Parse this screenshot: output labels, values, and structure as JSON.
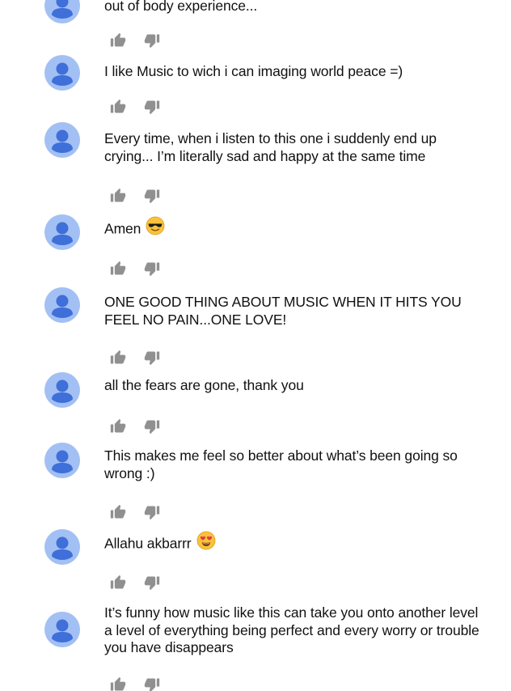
{
  "colors": {
    "avatar_bg": "#a3c0f4",
    "avatar_fg": "#3f6fd8",
    "icon": "#909090",
    "text": "#111111"
  },
  "comments": [
    {
      "text": "out of body experience..."
    },
    {
      "text": "I like Music to wich i can imaging world peace =)"
    },
    {
      "text": "Every time, when i listen to this one i suddenly end up crying... I’m literally sad and happy at the same time"
    },
    {
      "text": "Amen",
      "emoji": "smiling-face-with-sunglasses-emoji"
    },
    {
      "text": "ONE GOOD THING ABOUT MUSIC WHEN IT HITS YOU FEEL NO PAIN...ONE LOVE!"
    },
    {
      "text": "all the fears are gone, thank you"
    },
    {
      "text": "This makes me feel so better about what’s been going so wrong :)"
    },
    {
      "text": "Allahu akbarrr",
      "emoji": "smiling-face-with-heart-eyes-emoji"
    },
    {
      "text": "It’s funny how music like this can take you onto another level a level of everything being perfect and every worry or trouble you have disappears"
    }
  ],
  "icons": {
    "avatar": "default-user-avatar-icon",
    "like": "thumbs-up-icon",
    "dislike": "thumbs-down-icon"
  }
}
